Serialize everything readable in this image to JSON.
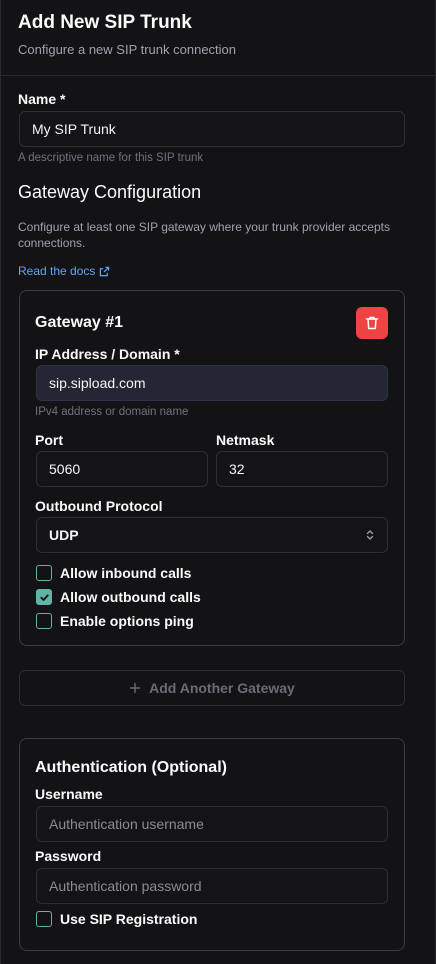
{
  "header": {
    "title": "Add New SIP Trunk",
    "subtitle": "Configure a new SIP trunk connection"
  },
  "name_field": {
    "label": "Name *",
    "value": "My SIP Trunk",
    "help": "A descriptive name for this SIP trunk"
  },
  "gateway_section": {
    "title": "Gateway Configuration",
    "description": "Configure at least one SIP gateway where your trunk provider accepts connections.",
    "docs_link": "Read the docs"
  },
  "gateway": {
    "title": "Gateway #1",
    "address_label": "IP Address / Domain *",
    "address_value": "sip.sipload.com",
    "address_help": "IPv4 address or domain name",
    "port_label": "Port",
    "port_value": "5060",
    "netmask_label": "Netmask",
    "netmask_value": "32",
    "protocol_label": "Outbound Protocol",
    "protocol_value": "UDP",
    "checkboxes": [
      {
        "label": "Allow inbound calls",
        "checked": false
      },
      {
        "label": "Allow outbound calls",
        "checked": true
      },
      {
        "label": "Enable options ping",
        "checked": false
      }
    ]
  },
  "add_gateway_label": "Add Another Gateway",
  "auth": {
    "title": "Authentication (Optional)",
    "username_label": "Username",
    "username_placeholder": "Authentication username",
    "password_label": "Password",
    "password_placeholder": "Authentication password",
    "registration_label": "Use SIP Registration",
    "registration_checked": false
  },
  "colors": {
    "accent": "#5eb5a6",
    "danger": "#ef4444",
    "link": "#60a5fa",
    "background": "#131316"
  }
}
